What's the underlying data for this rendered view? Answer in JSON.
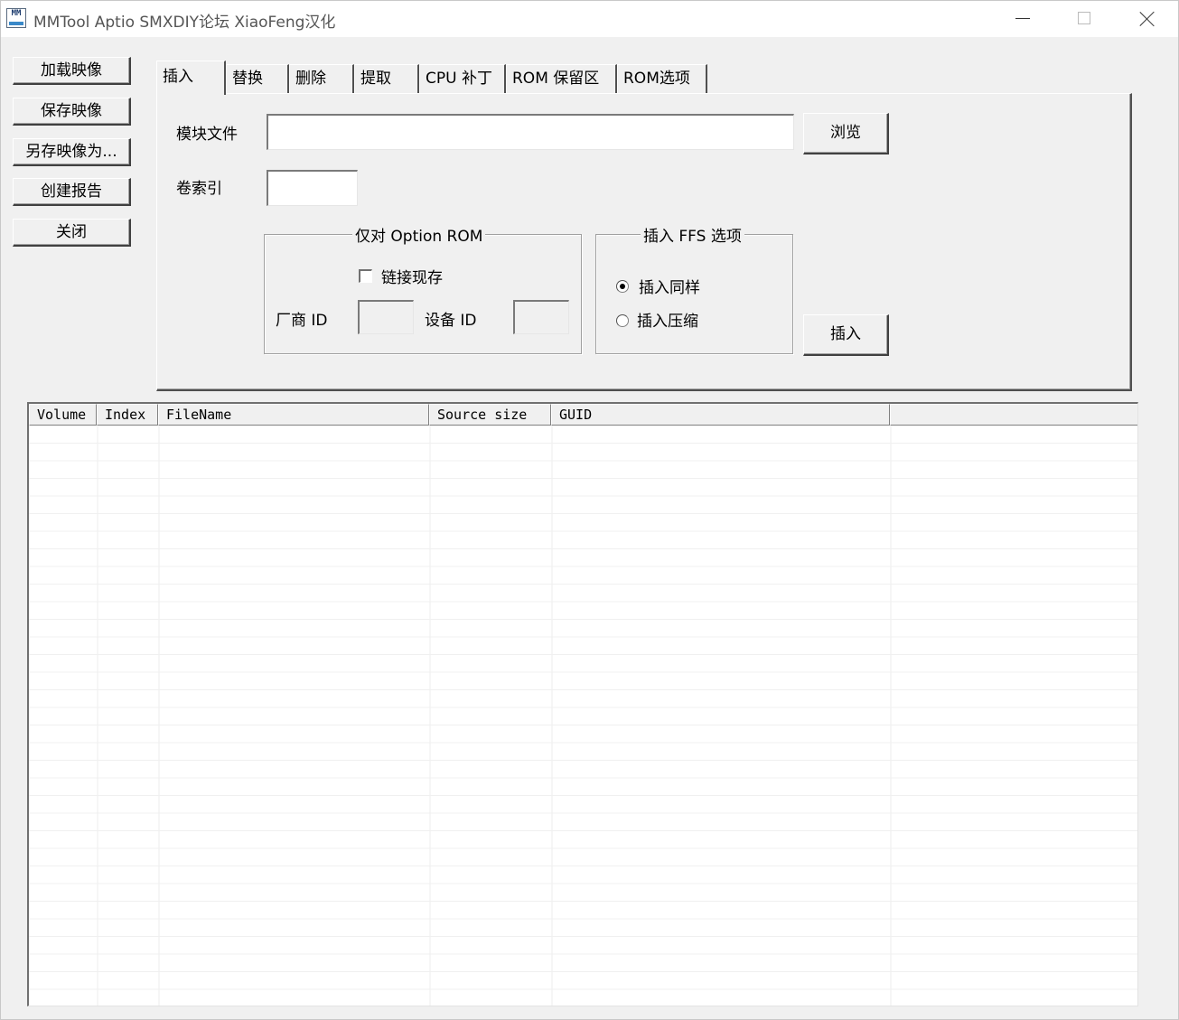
{
  "window": {
    "title": "MMTool Aptio SMXDIY论坛 XiaoFeng汉化",
    "icon": "mmtool-app-icon",
    "icon_text": "MM"
  },
  "left_buttons": [
    {
      "label": "加载映像"
    },
    {
      "label": "保存映像"
    },
    {
      "label": "另存映像为..."
    },
    {
      "label": "创建报告"
    },
    {
      "label": "关闭"
    }
  ],
  "tabs": [
    {
      "label": "插入",
      "active": true
    },
    {
      "label": "替换"
    },
    {
      "label": "删除"
    },
    {
      "label": "提取"
    },
    {
      "label": "CPU 补丁"
    },
    {
      "label": "ROM 保留区"
    },
    {
      "label": "ROM选项"
    }
  ],
  "insert_tab": {
    "module_file_label": "模块文件",
    "module_file_value": "",
    "browse_label": "浏览",
    "volume_index_label": "卷索引",
    "volume_index_value": "",
    "option_rom_group": {
      "title": "仅对 Option ROM",
      "link_present_label": "链接现存",
      "link_present_checked": false,
      "vendor_id_label": "厂商 ID",
      "vendor_id_value": "",
      "device_id_label": "设备 ID",
      "device_id_value": ""
    },
    "ffs_group": {
      "title": "插入 FFS 选项",
      "options": [
        {
          "label": "插入同样",
          "selected": true
        },
        {
          "label": "插入压缩",
          "selected": false
        }
      ]
    },
    "insert_button_label": "插入"
  },
  "list": {
    "columns": [
      "Volume",
      "Index",
      "FileName",
      "Source size",
      "GUID",
      ""
    ],
    "rows": []
  }
}
